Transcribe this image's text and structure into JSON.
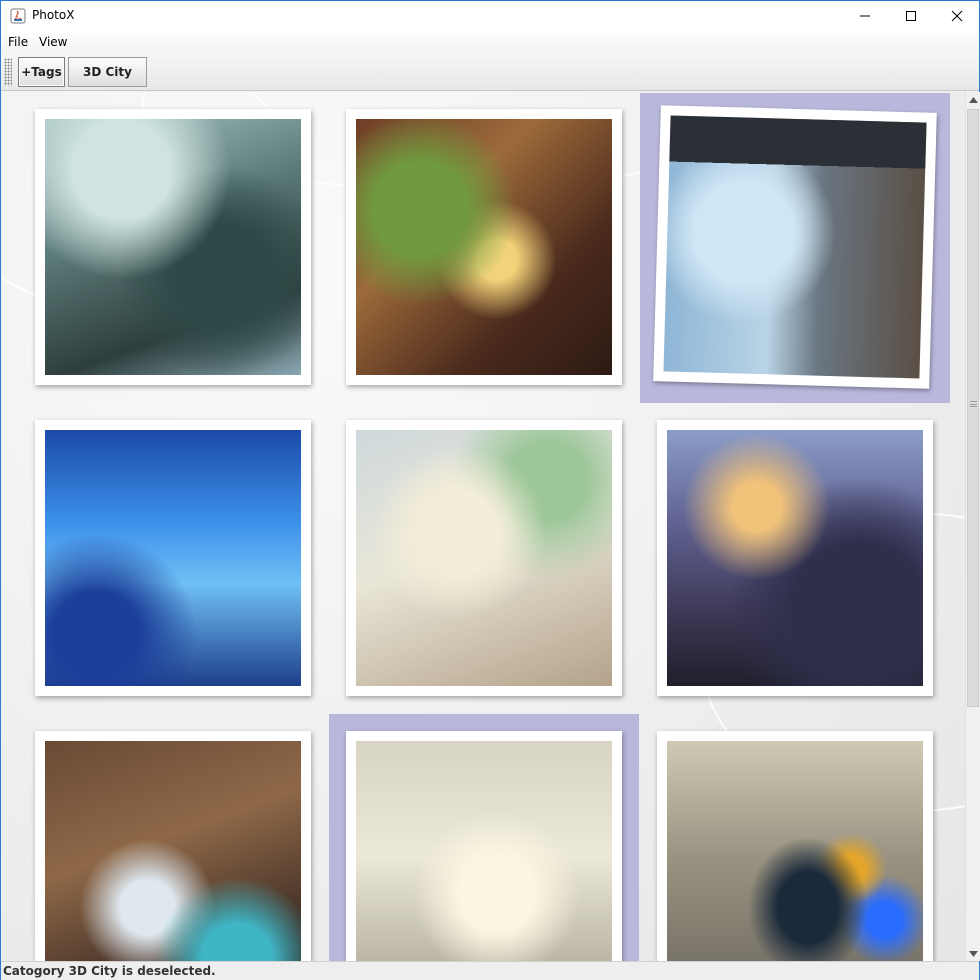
{
  "window": {
    "title": "PhotoX",
    "minimize_glyph": "—",
    "maximize_glyph": "☐",
    "close_glyph": "✕"
  },
  "menubar": {
    "items": [
      {
        "label": "File"
      },
      {
        "label": "View"
      }
    ]
  },
  "toolbar": {
    "tags_label": "+Tags",
    "city_label": "3D City"
  },
  "gallery": {
    "columns": 3,
    "items": [
      {
        "image": "steampunk-city-artwork",
        "selected": false
      },
      {
        "image": "library-room-girl-artwork",
        "selected": false
      },
      {
        "image": "window-view-city-artwork",
        "selected": true
      },
      {
        "image": "upside-down-city-schoolgirls-artwork",
        "selected": false
      },
      {
        "image": "girl-on-balcony-artwork",
        "selected": false
      },
      {
        "image": "fantasy-night-city-artwork",
        "selected": false
      },
      {
        "image": "messy-room-miku-artwork",
        "selected": false
      },
      {
        "image": "sketched-city-alley-artwork",
        "selected": true
      },
      {
        "image": "spaceship-in-clouds-artwork",
        "selected": false
      }
    ]
  },
  "colors": {
    "selection_highlight": "#b9b8dc",
    "window_border": "#2b79d1"
  },
  "status": {
    "text": "Catogory 3D City is deselected."
  }
}
